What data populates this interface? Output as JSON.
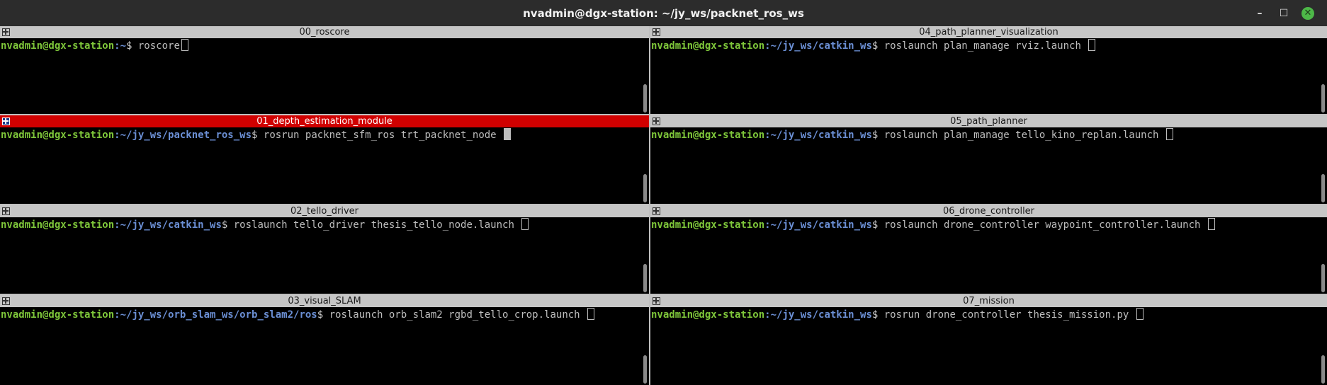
{
  "window": {
    "title": "nvadmin@dgx-station: ~/jy_ws/packnet_ros_ws",
    "minimize_glyph": "–",
    "maximize_glyph": "☐",
    "close_glyph": "✕"
  },
  "panes": [
    {
      "title": "00_roscore",
      "user": "nvadmin@dgx-station",
      "path": ":~",
      "prompt": "$ ",
      "command": "roscore",
      "active": false
    },
    {
      "title": "01_depth_estimation_module",
      "user": "nvadmin@dgx-station",
      "path": ":~/jy_ws/packnet_ros_ws",
      "prompt": "$ ",
      "command": "rosrun packnet_sfm_ros trt_packnet_node ",
      "active": true
    },
    {
      "title": "02_tello_driver",
      "user": "nvadmin@dgx-station",
      "path": ":~/jy_ws/catkin_ws",
      "prompt": "$ ",
      "command": "roslaunch tello_driver thesis_tello_node.launch ",
      "active": false
    },
    {
      "title": "03_visual_SLAM",
      "user": "nvadmin@dgx-station",
      "path": ":~/jy_ws/orb_slam_ws/orb_slam2/ros",
      "prompt": "$ ",
      "command": "roslaunch orb_slam2 rgbd_tello_crop.launch ",
      "active": false
    },
    {
      "title": "04_path_planner_visualization",
      "user": "nvadmin@dgx-station",
      "path": ":~/jy_ws/catkin_ws",
      "prompt": "$ ",
      "command": "roslaunch plan_manage rviz.launch ",
      "active": false
    },
    {
      "title": "05_path_planner",
      "user": "nvadmin@dgx-station",
      "path": ":~/jy_ws/catkin_ws",
      "prompt": "$ ",
      "command": "roslaunch plan_manage tello_kino_replan.launch ",
      "active": false
    },
    {
      "title": "06_drone_controller",
      "user": "nvadmin@dgx-station",
      "path": ":~/jy_ws/catkin_ws",
      "prompt": "$ ",
      "command": "roslaunch drone_controller waypoint_controller.launch ",
      "active": false
    },
    {
      "title": "07_mission",
      "user": "nvadmin@dgx-station",
      "path": ":~/jy_ws/catkin_ws",
      "prompt": "$ ",
      "command": "rosrun drone_controller thesis_mission.py ",
      "active": false
    }
  ],
  "colors": {
    "active_header": "#d00000",
    "inactive_header": "#c6c6c6",
    "user_green": "#7ec63a",
    "path_blue": "#6b8fd4"
  }
}
